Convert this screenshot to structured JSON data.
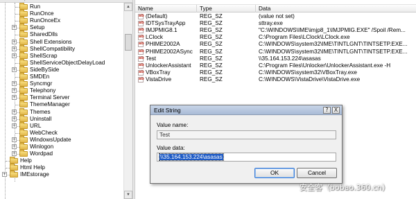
{
  "tree": {
    "partial_top": "vip",
    "items": [
      {
        "label": "Run",
        "expander": false
      },
      {
        "label": "RunOnce",
        "expander": false
      },
      {
        "label": "RunOnceEx",
        "expander": false
      },
      {
        "label": "Setup",
        "expander": true
      },
      {
        "label": "SharedDlls",
        "expander": false
      },
      {
        "label": "Shell Extensions",
        "expander": true
      },
      {
        "label": "ShellCompatibility",
        "expander": true
      },
      {
        "label": "ShellScrap",
        "expander": true
      },
      {
        "label": "ShellServiceObjectDelayLoad",
        "expander": false
      },
      {
        "label": "SideBySide",
        "expander": true
      },
      {
        "label": "SMDEn",
        "expander": false
      },
      {
        "label": "Syncmgr",
        "expander": true
      },
      {
        "label": "Telephony",
        "expander": true
      },
      {
        "label": "Terminal Server",
        "expander": true
      },
      {
        "label": "ThemeManager",
        "expander": false
      },
      {
        "label": "Themes",
        "expander": true
      },
      {
        "label": "Uninstall",
        "expander": true
      },
      {
        "label": "URL",
        "expander": true
      },
      {
        "label": "WebCheck",
        "expander": false
      },
      {
        "label": "WindowsUpdate",
        "expander": true
      },
      {
        "label": "Winlogon",
        "expander": true
      },
      {
        "label": "Wordpad",
        "expander": true
      },
      {
        "label": "Help",
        "expander": false,
        "level": 1
      },
      {
        "label": "Html Help",
        "expander": false,
        "level": 1
      },
      {
        "label": "IMEstorage",
        "expander": true,
        "level": 1
      }
    ]
  },
  "values": {
    "headers": {
      "name": "Name",
      "type": "Type",
      "data": "Data"
    },
    "rows": [
      {
        "name": "(Default)",
        "type": "REG_SZ",
        "data": "(value not set)"
      },
      {
        "name": "IDTSysTrayApp",
        "type": "REG_SZ",
        "data": "sttray.exe"
      },
      {
        "name": "IMJPMIG8.1",
        "type": "REG_SZ",
        "data": "\"C:\\WINDOWS\\IME\\imjp8_1\\IMJPMIG.EXE\" /Spoil /Rem..."
      },
      {
        "name": "LClock",
        "type": "REG_SZ",
        "data": "C:\\Program Files\\LClock\\LClock.exe"
      },
      {
        "name": "PHIME2002A",
        "type": "REG_SZ",
        "data": "C:\\WINDOWS\\system32\\IME\\TINTLGNT\\TINTSETP.EXE..."
      },
      {
        "name": "PHIME2002ASync",
        "type": "REG_SZ",
        "data": "C:\\WINDOWS\\system32\\IME\\TINTLGNT\\TINTSETP.EXE..."
      },
      {
        "name": "Test",
        "type": "REG_SZ",
        "data": "\\\\35.164.153.224\\asasas"
      },
      {
        "name": "UnlockerAssistant",
        "type": "REG_SZ",
        "data": "C:\\Program Files\\Unlocker\\UnlockerAssistant.exe -H"
      },
      {
        "name": "VBoxTray",
        "type": "REG_SZ",
        "data": "C:\\WINDOWS\\system32\\VBoxTray.exe"
      },
      {
        "name": "VistaDrive",
        "type": "REG_SZ",
        "data": "C:\\WINDOWS\\VistaDrive\\VistaDrive.exe"
      }
    ]
  },
  "dialog": {
    "title": "Edit String",
    "help_button": "?",
    "close_button": "X",
    "value_name_label": "Value name:",
    "value_name": "Test",
    "value_data_label": "Value data:",
    "value_data": "\\\\35.164.153.224\\asasas",
    "ok_label": "OK",
    "cancel_label": "Cancel"
  },
  "watermark": "安全客（bobao.360.cn）"
}
